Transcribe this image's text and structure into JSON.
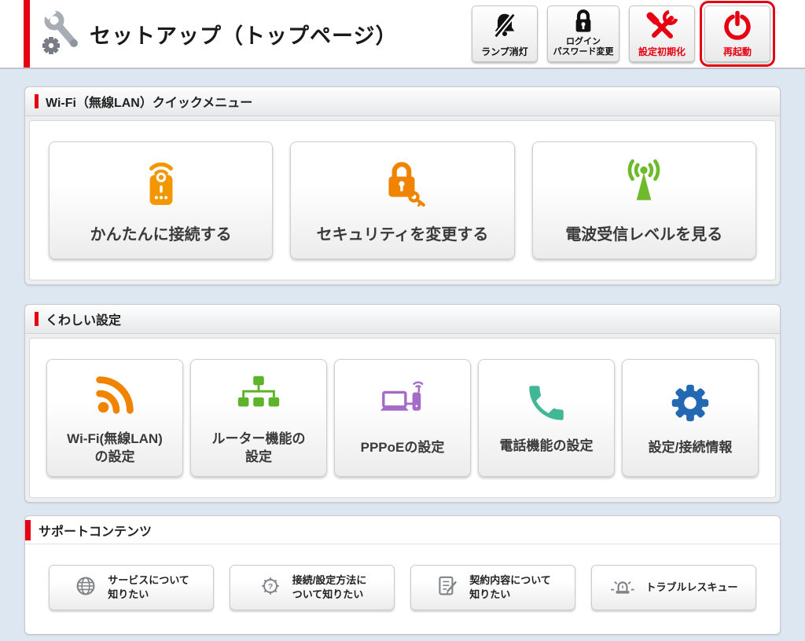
{
  "colors": {
    "accent_red": "#e60012",
    "orange": "#f39700",
    "green": "#6fb92c",
    "leaf_green": "#5db32a",
    "purple": "#a46cc6",
    "teal": "#41b795",
    "blue": "#2368b2",
    "icon_gray": "#7f8489",
    "page_bg": "#dde7f1"
  },
  "header": {
    "title": "セットアップ（トップページ）",
    "buttons": [
      {
        "lines": [
          "ランプ消灯"
        ]
      },
      {
        "lines": [
          "ログイン",
          "パスワード変更"
        ]
      },
      {
        "lines": [
          "設定初期化"
        ]
      },
      {
        "lines": [
          "再起動"
        ]
      }
    ]
  },
  "quick_menu": {
    "title": "Wi-Fi（無線LAN）クイックメニュー",
    "items": [
      {
        "label": "かんたんに接続する"
      },
      {
        "label": "セキュリティを変更する"
      },
      {
        "label": "電波受信レベルを見る"
      }
    ]
  },
  "settings_menu": {
    "title": "くわしい設定",
    "items": [
      {
        "lines": [
          "Wi-Fi(無線LAN)",
          "の設定"
        ]
      },
      {
        "lines": [
          "ルーター機能の",
          "設定"
        ]
      },
      {
        "lines": [
          "PPPoEの設定"
        ]
      },
      {
        "lines": [
          "電話機能の設定"
        ]
      },
      {
        "lines": [
          "設定/接続情報"
        ]
      }
    ]
  },
  "support": {
    "title": "サポートコンテンツ",
    "items": [
      {
        "lines": [
          "サービスについて",
          "知りたい"
        ]
      },
      {
        "lines": [
          "接続/設定方法に",
          "ついて知りたい"
        ]
      },
      {
        "lines": [
          "契約内容について",
          "知りたい"
        ]
      },
      {
        "lines": [
          "トラブルレスキュー"
        ]
      }
    ]
  }
}
